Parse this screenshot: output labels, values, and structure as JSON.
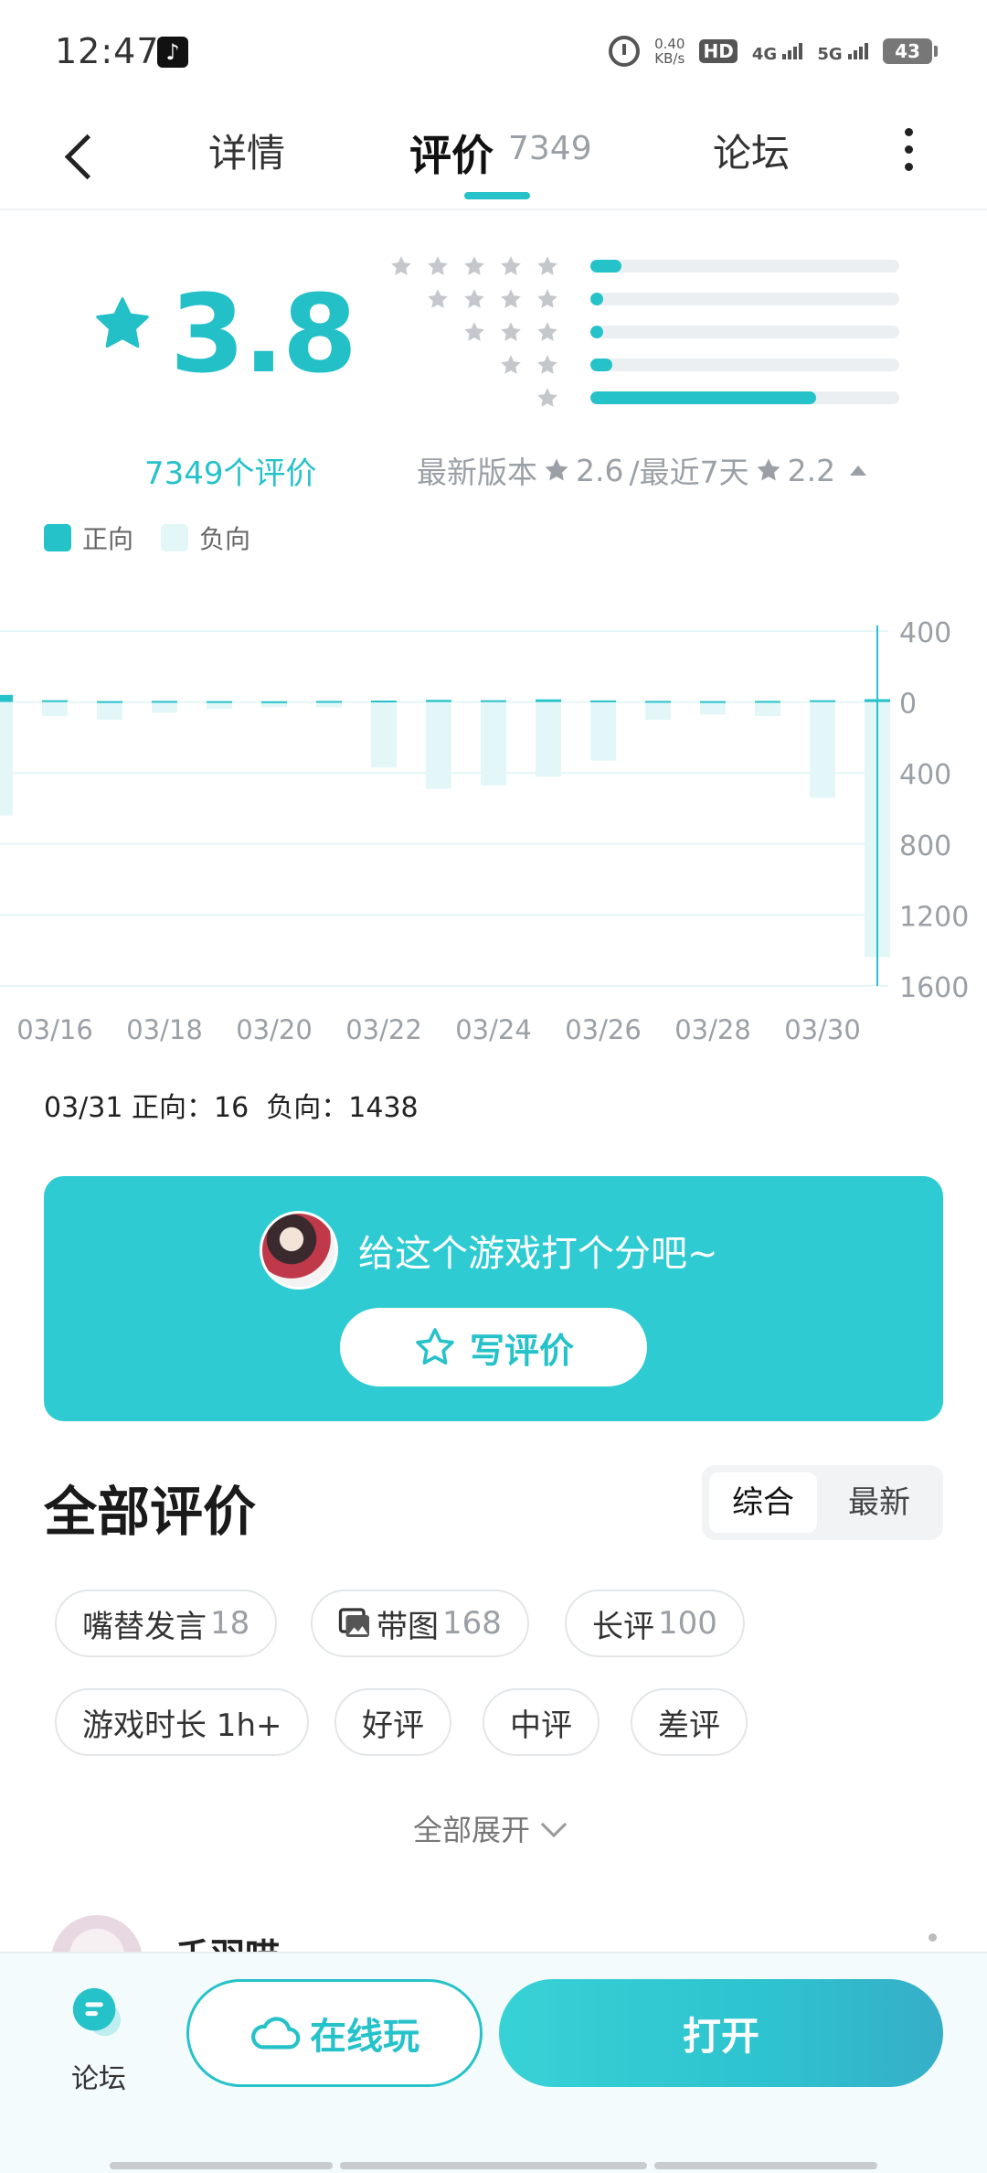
{
  "status": {
    "time": "12:47",
    "speed_value": "0.40",
    "speed_unit": "KB/s",
    "hd": "HD",
    "net1": "4G",
    "net2": "5G",
    "battery": "43"
  },
  "nav": {
    "tabs": [
      {
        "label": "详情"
      },
      {
        "label": "评价",
        "count": "7349"
      },
      {
        "label": "论坛"
      }
    ],
    "active_tab": "评价"
  },
  "rating": {
    "score": "3.8",
    "total_label": "7349个评价",
    "distribution": [
      {
        "stars": 5,
        "fraction": 0.1
      },
      {
        "stars": 4,
        "fraction": 0.04
      },
      {
        "stars": 3,
        "fraction": 0.04
      },
      {
        "stars": 2,
        "fraction": 0.07
      },
      {
        "stars": 1,
        "fraction": 0.73
      }
    ],
    "latest_version_label": "最新版本",
    "latest_version_score": "2.6",
    "recent_label": "/最近7天",
    "recent_score": "2.2"
  },
  "legend": {
    "positive": "正向",
    "negative": "负向",
    "positive_color": "#26c2c9",
    "negative_color": "#e4f7f8"
  },
  "chart_data": {
    "type": "bar",
    "categories": [
      "03/15",
      "03/16",
      "03/17",
      "03/18",
      "03/19",
      "03/20",
      "03/21",
      "03/22",
      "03/23",
      "03/24",
      "03/25",
      "03/26",
      "03/27",
      "03/28",
      "03/29",
      "03/30",
      "03/31"
    ],
    "x_tick_labels": [
      "03/16",
      "03/18",
      "03/20",
      "03/22",
      "03/24",
      "03/26",
      "03/28",
      "03/30"
    ],
    "y_tick_labels": [
      "400",
      "0",
      "400",
      "800",
      "1200",
      "1600"
    ],
    "series": [
      {
        "name": "正向",
        "values": [
          40,
          10,
          5,
          6,
          5,
          4,
          6,
          8,
          12,
          10,
          15,
          9,
          6,
          5,
          6,
          10,
          16
        ]
      },
      {
        "name": "负向",
        "values": [
          640,
          80,
          100,
          60,
          40,
          30,
          30,
          370,
          490,
          470,
          420,
          330,
          100,
          70,
          80,
          540,
          1438
        ]
      }
    ],
    "ylim": [
      -1600,
      400
    ],
    "selected_index": 16
  },
  "selected": {
    "date": "03/31",
    "positive_label": "正向",
    "positive_value": "16",
    "negative_label": "负向",
    "negative_value": "1438"
  },
  "rate_card": {
    "prompt": "给这个游戏打个分吧~",
    "button_label": "写评价"
  },
  "reviews": {
    "title": "全部评价",
    "sort_options": [
      "综合",
      "最新"
    ],
    "active_sort": "综合",
    "chips": [
      {
        "label": "嘴替发言",
        "count": "18"
      },
      {
        "label": "带图",
        "count": "168"
      },
      {
        "label": "长评",
        "count": "100"
      },
      {
        "label": "游戏时长 1h+",
        "count": ""
      },
      {
        "label": "好评",
        "count": ""
      },
      {
        "label": "中评",
        "count": ""
      },
      {
        "label": "差评",
        "count": ""
      }
    ],
    "expand_label": "全部展开",
    "first_review_user": "千羽喵"
  },
  "bottom": {
    "forum_label": "论坛",
    "play_online_label": "在线玩",
    "open_label": "打开"
  }
}
